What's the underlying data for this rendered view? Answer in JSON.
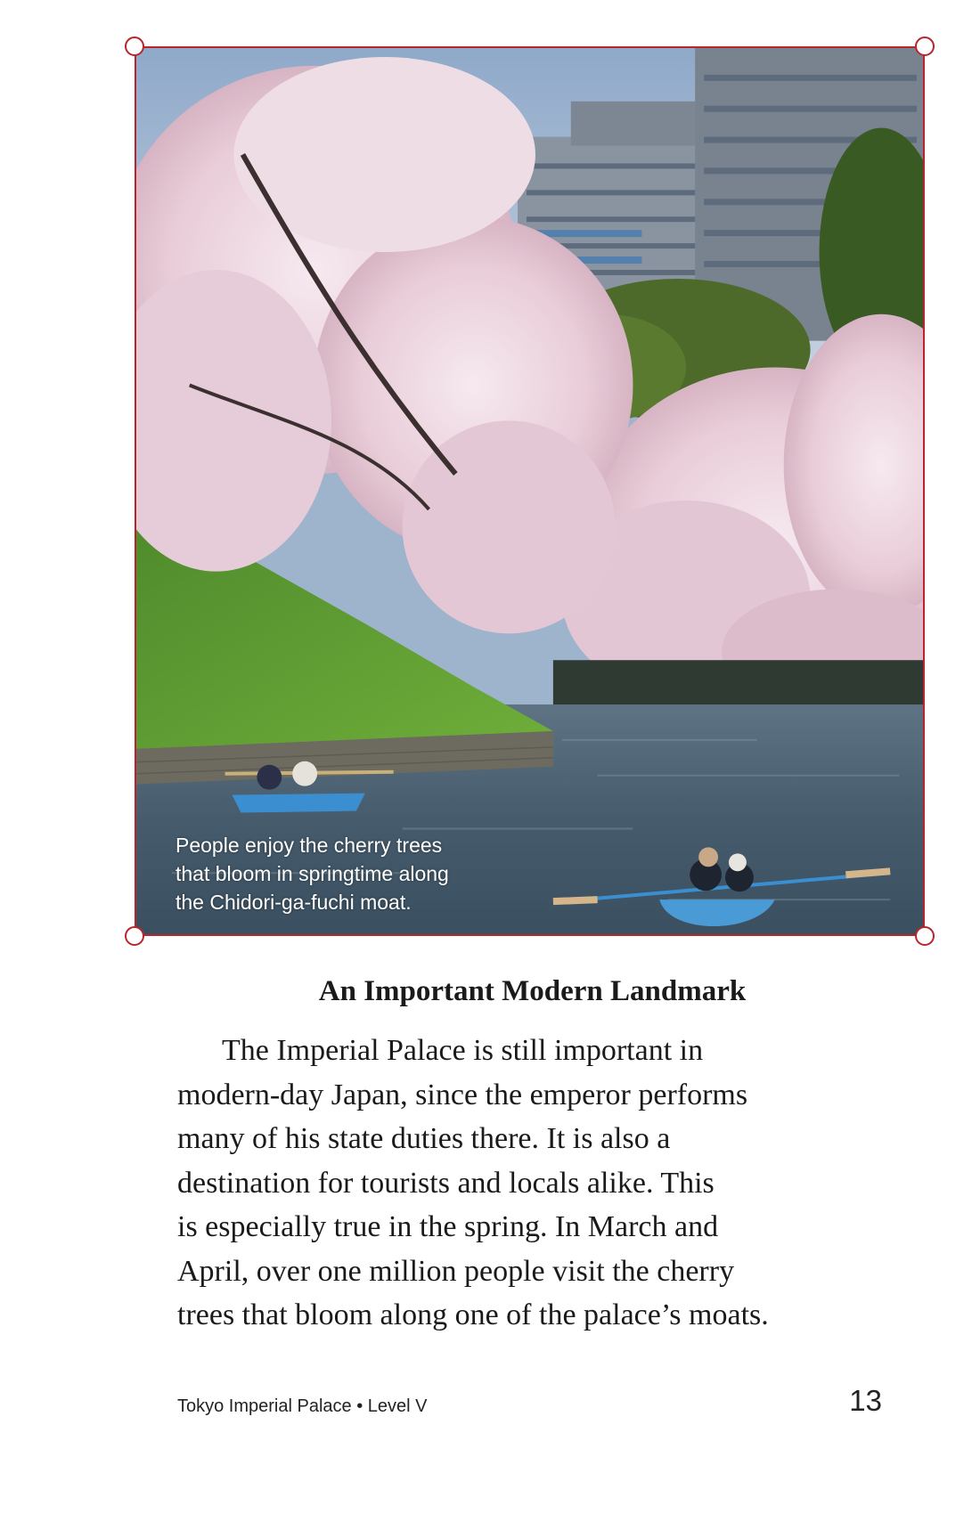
{
  "photo": {
    "caption_lines": [
      "People enjoy the cherry trees",
      "that bloom in springtime along",
      "the Chidori-ga-fuchi moat."
    ],
    "frame_color": "#b8252c"
  },
  "section": {
    "heading": "An Important Modern Landmark",
    "paragraph_lines": [
      "The Imperial Palace is still important in",
      "modern-day Japan, since the emperor performs",
      "many of his state duties there. It is also a",
      "destination for tourists and locals alike. This",
      "is especially true in the spring. In March and",
      "April, over one million people visit the cherry",
      "trees that bloom along one of the palace’s moats."
    ]
  },
  "footer": {
    "book_title": "Tokyo Imperial Palace • Level V",
    "page_number": "13"
  }
}
